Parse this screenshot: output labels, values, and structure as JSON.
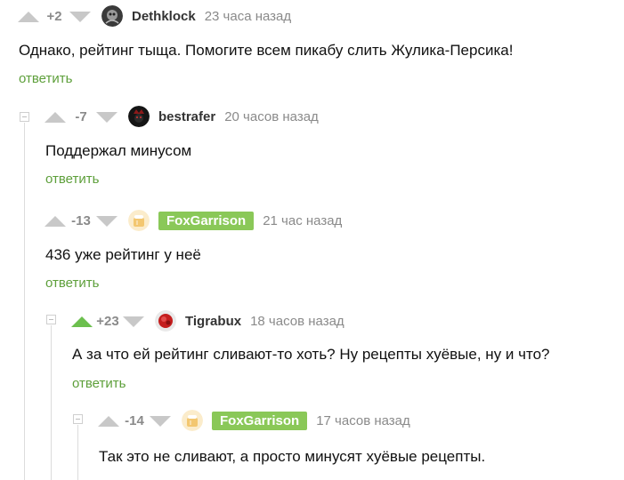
{
  "comments": [
    {
      "rating": "+2",
      "user": "Dethklock",
      "time": "23 часа назад",
      "text": "Однако, рейтинг тыща. Помогите всем пикабу слить Жулика-Персика!",
      "reply": "ответить"
    },
    {
      "rating": "-7",
      "user": "bestrafer",
      "time": "20 часов назад",
      "text": "Поддержал минусом",
      "reply": "ответить"
    },
    {
      "rating": "-13",
      "user": "FoxGarrison",
      "time": "21 час назад",
      "text": "436 уже рейтинг у неё",
      "reply": "ответить"
    },
    {
      "rating": "+23",
      "user": "Tigrabux",
      "time": "18 часов назад",
      "text": "А за что ей рейтинг сливают-то хоть? Ну рецепты хуёвые, ну и что?",
      "reply": "ответить"
    },
    {
      "rating": "-14",
      "user": "FoxGarrison",
      "time": "17 часов назад",
      "text": "Так это не сливают, а просто минусят хуёвые рецепты.",
      "reply": ""
    }
  ],
  "colors": {
    "accent_green": "#5d9f3a",
    "badge_green": "#8ac858",
    "vote_gray": "#c8c8c8",
    "upvoted_green": "#6cbf4e"
  }
}
